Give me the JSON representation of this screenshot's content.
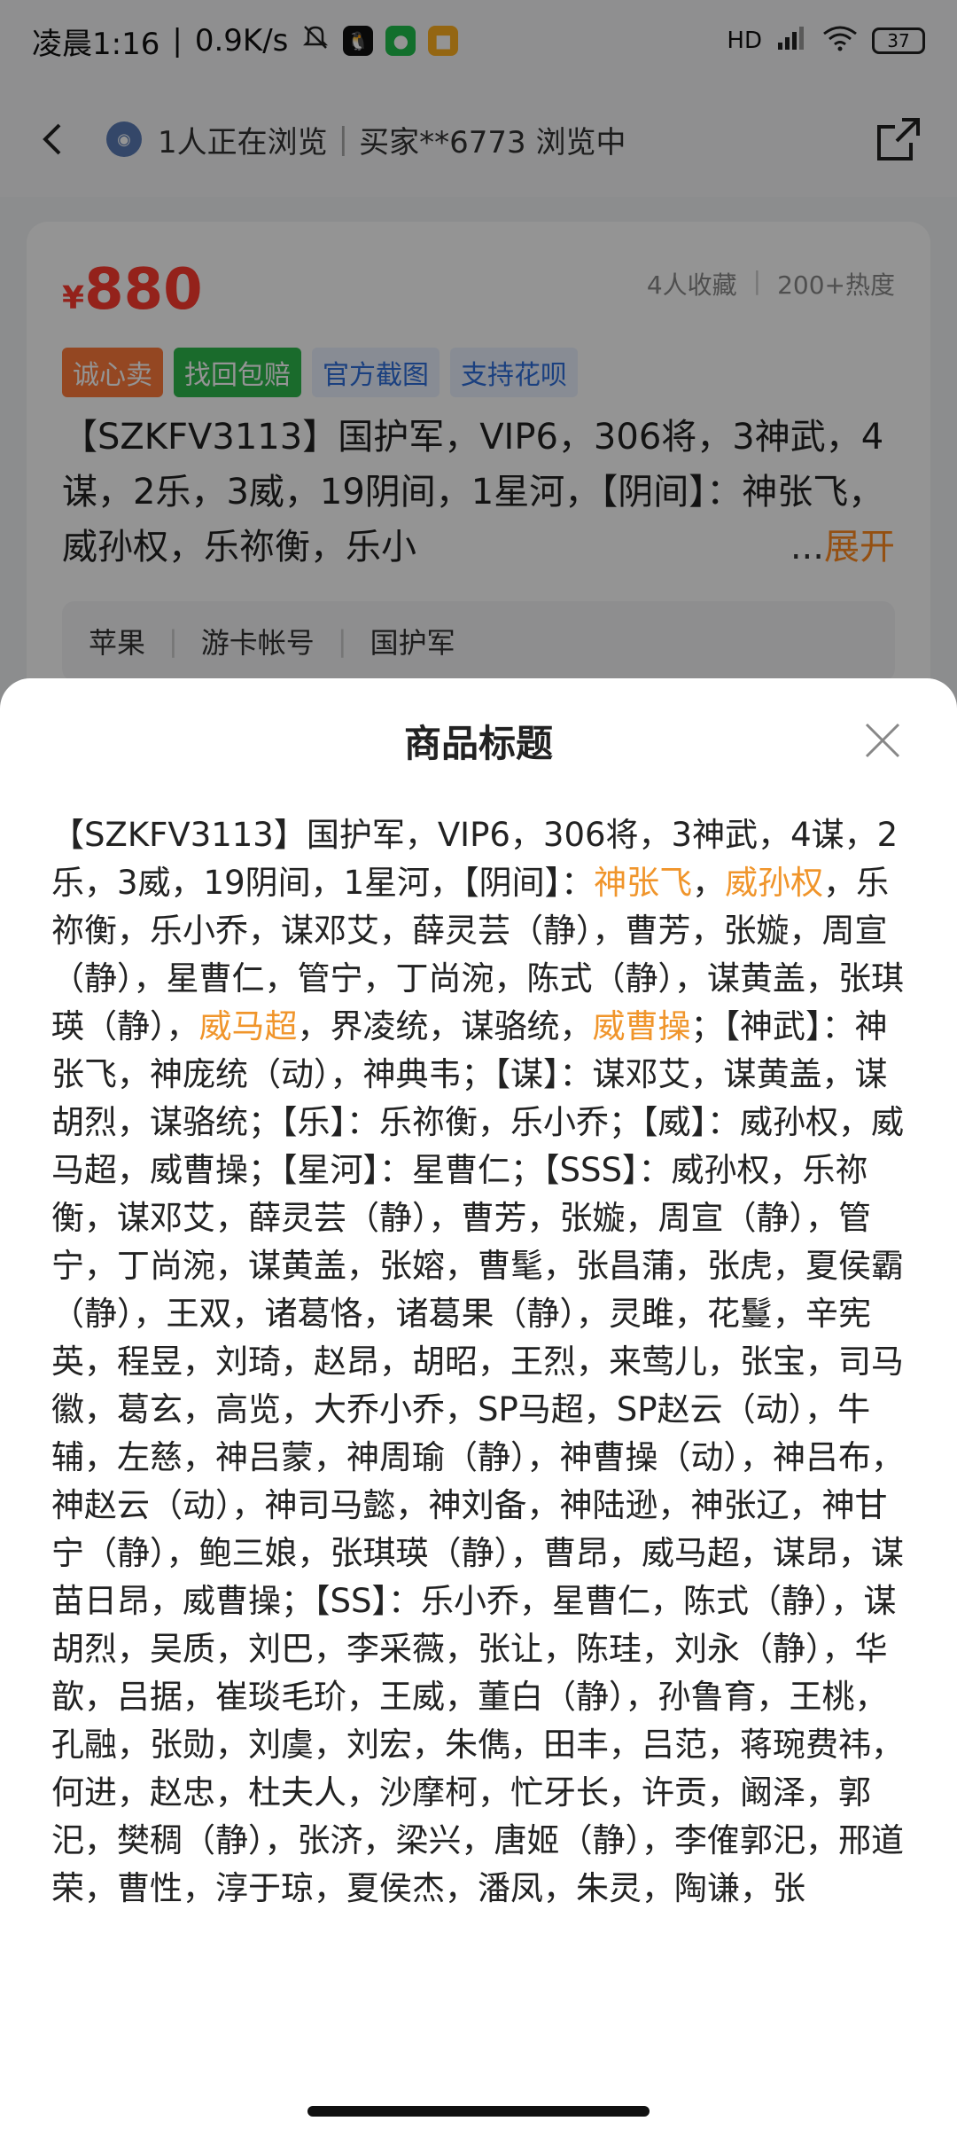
{
  "status_bar": {
    "time": "凌晨1:16",
    "speed": "0.9K/s",
    "battery": "37",
    "signal_label": "HD"
  },
  "nav": {
    "viewers": "1人正在浏览",
    "buyer": "买家**6773 浏览中"
  },
  "listing": {
    "currency": "¥",
    "price": "880",
    "favorites": "4人收藏",
    "heat": "200+热度",
    "tags": [
      "诚心卖",
      "找回包赔",
      "官方截图",
      "支持花呗"
    ],
    "title_preview": "【SZKFV3113】国护军，VIP6，306将，3神武，4谋，2乐，3威，19阴间，1星河，【阴间】：神张飞，威孙权，乐祢衡，乐小",
    "expand_ellipsis": "...",
    "expand_label": "展开",
    "attributes": [
      "苹果",
      "游卡帐号",
      "国护军"
    ]
  },
  "sheet": {
    "title": "商品标题",
    "segments": [
      {
        "text": "【SZKFV3113】国护军，VIP6，306将，3神武，4谋，2乐，3威，19阴间，1星河，【阴间】：",
        "hl": false
      },
      {
        "text": "神张飞",
        "hl": true
      },
      {
        "text": "，",
        "hl": false
      },
      {
        "text": "威孙权",
        "hl": true
      },
      {
        "text": "，乐祢衡，乐小乔，谋邓艾，薛灵芸（静），曹芳，张嫙，周宣（静），星曹仁，管宁，丁尚涴，陈式（静），谋黄盖，张琪瑛（静），",
        "hl": false
      },
      {
        "text": "威马超",
        "hl": true
      },
      {
        "text": "，界凌统，谋骆统，",
        "hl": false
      },
      {
        "text": "威曹操",
        "hl": true
      },
      {
        "text": "；【神武】：神张飞，神庞统（动），神典韦；【谋】：谋邓艾，谋黄盖，谋胡烈，谋骆统；【乐】：乐祢衡，乐小乔；【威】：威孙权，威马超，威曹操；【星河】：星曹仁；【SSS】：威孙权，乐祢衡，谋邓艾，薛灵芸（静），曹芳，张嫙，周宣（静），管宁，丁尚涴，谋黄盖，张嫆，曹髦，张昌蒲，张虎，夏侯霸（静），王双，诸葛恪，诸葛果（静），灵雎，花鬘，辛宪英，程昱，刘琦，赵昂，胡昭，王烈，来莺儿，张宝，司马徽，葛玄，高览，大乔小乔，SP马超，SP赵云（动），牛辅，左慈，神吕蒙，神周瑜（静），神曹操（动），神吕布，神赵云（动），神司马懿，神刘备，神陆逊，神张辽，神甘宁（静），鲍三娘，张琪瑛（静），曹昂，威马超，谋昂，谋苗日昂，威曹操；【SS】：乐小乔，星曹仁，陈式（静），谋胡烈，吴质，刘巴，李采薇，张让，陈珪，刘永（静），华歆，吕据，崔琰毛玠，王威，董白（静），孙鲁育，王桃，孔融，张勋，刘虞，刘宏，朱儁，田丰，吕范，蒋琬费祎，何进，赵忠，杜夫人，沙摩柯，忙牙长，许贡，阚泽，郭汜，樊稠（静），张济，梁兴，唐姬（静），李傕郭汜，邢道荣，曹性，淳于琼，夏侯杰，潘凤，朱灵，陶谦，张",
        "hl": false
      }
    ]
  },
  "colors": {
    "price": "#ff3b30",
    "highlight": "#f0952b",
    "expand": "#ff8a1f"
  },
  "icons": [
    "back-icon",
    "avatar-icon",
    "share-icon",
    "close-icon",
    "wifi-icon",
    "signal-icon",
    "battery-icon",
    "mute-icon",
    "qq-icon",
    "wechat-icon",
    "notification-icon"
  ]
}
